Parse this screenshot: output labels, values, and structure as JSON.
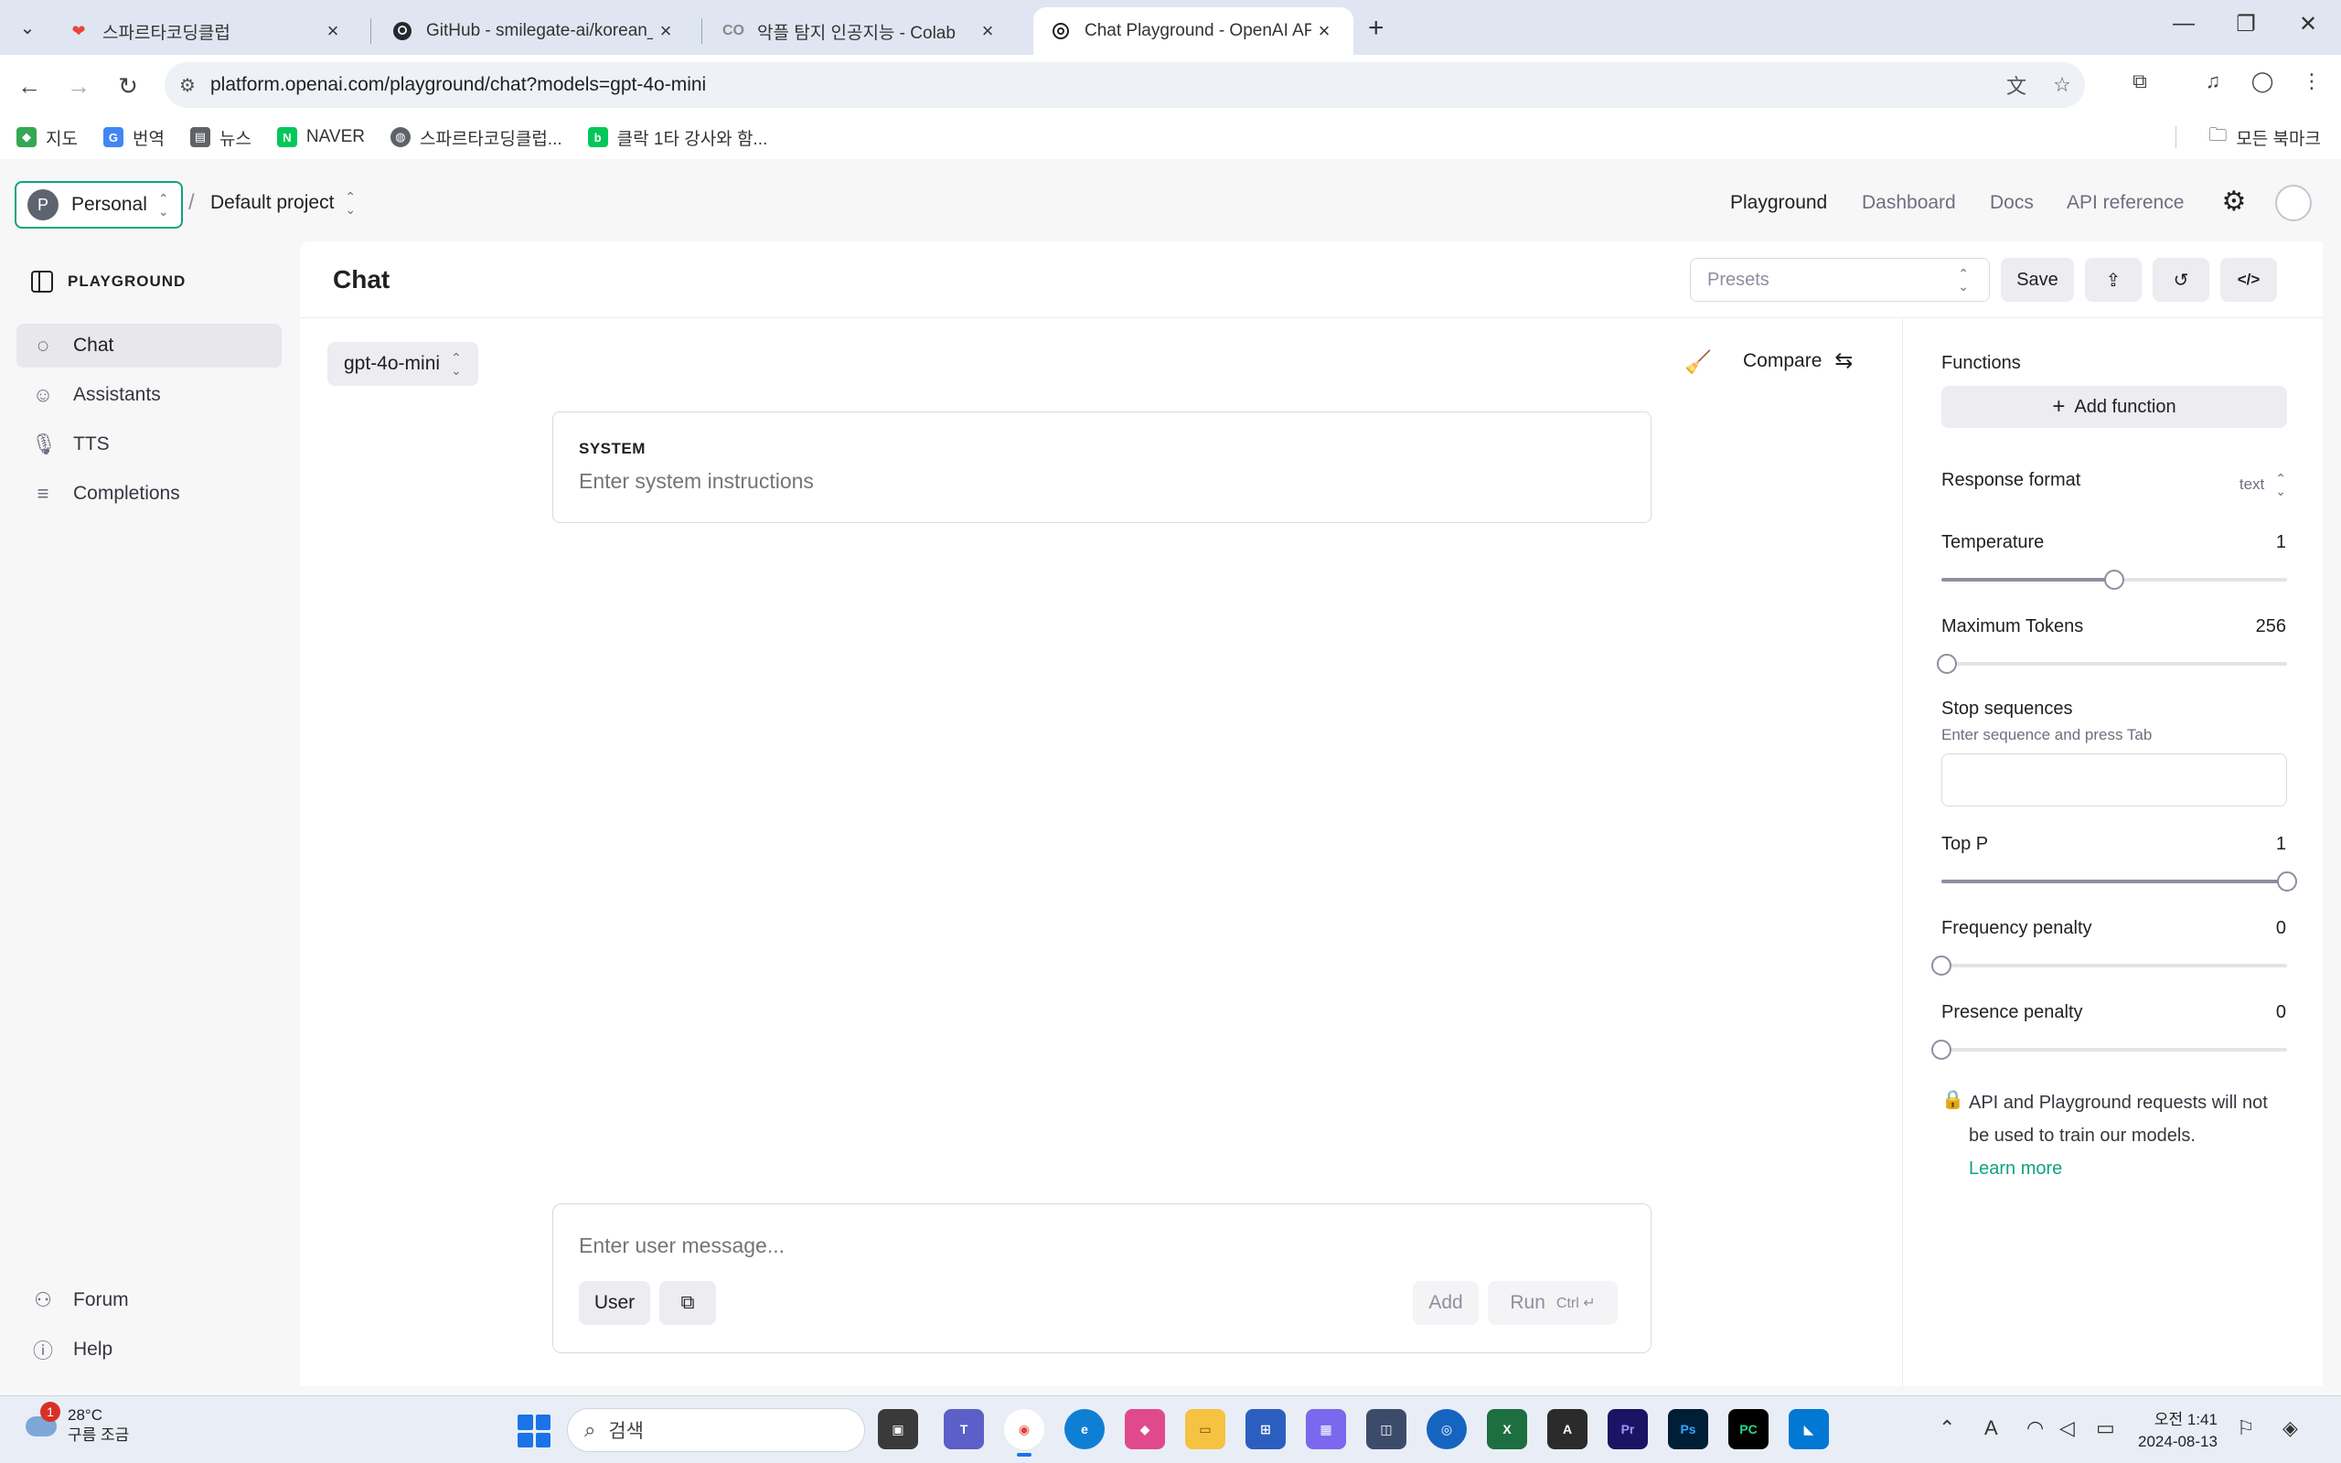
{
  "browser": {
    "tabs": [
      {
        "title": "스파르타코딩클럽",
        "favicon": "heart-icon",
        "color": "#e8453c"
      },
      {
        "title": "GitHub - smilegate-ai/korean_",
        "favicon": "github-icon",
        "color": "#24292f"
      },
      {
        "title": "악플 탐지 인공지능 - Colab",
        "favicon": "colab-icon",
        "color": "#f9ab00"
      },
      {
        "title": "Chat Playground - OpenAI API",
        "favicon": "openai-icon",
        "color": "#202123"
      }
    ],
    "url": "platform.openai.com/playground/chat?models=gpt-4o-mini",
    "bookmarks": [
      {
        "label": "지도",
        "icon": "maps-icon",
        "color": "#34a853"
      },
      {
        "label": "번역",
        "icon": "translate-icon",
        "color": "#4285f4"
      },
      {
        "label": "뉴스",
        "icon": "news-icon",
        "color": "#5f6368"
      },
      {
        "label": "NAVER",
        "icon": "naver-icon",
        "color": "#03c75a"
      },
      {
        "label": "스파르타코딩클럽...",
        "icon": "globe-icon",
        "color": "#5f6368"
      },
      {
        "label": "클락 1타 강사와 함...",
        "icon": "blog-icon",
        "color": "#03c75a"
      }
    ],
    "all_bookmarks": "모든 북마크"
  },
  "header": {
    "org_initial": "P",
    "org": "Personal",
    "project": "Default project",
    "nav": [
      "Playground",
      "Dashboard",
      "Docs",
      "API reference"
    ]
  },
  "sidebar": {
    "section": "PLAYGROUND",
    "items": [
      {
        "label": "Chat",
        "icon": "chat-icon"
      },
      {
        "label": "Assistants",
        "icon": "assistants-icon"
      },
      {
        "label": "TTS",
        "icon": "microphone-icon"
      },
      {
        "label": "Completions",
        "icon": "lines-icon"
      }
    ],
    "footer": [
      {
        "label": "Forum",
        "icon": "people-icon"
      },
      {
        "label": "Help",
        "icon": "help-icon"
      }
    ]
  },
  "main": {
    "title": "Chat",
    "presets_placeholder": "Presets",
    "save_label": "Save",
    "model": "gpt-4o-mini",
    "compare_label": "Compare",
    "system_label": "SYSTEM",
    "system_placeholder": "Enter system instructions",
    "message_placeholder": "Enter user message...",
    "role_label": "User",
    "add_label": "Add",
    "run_label": "Run",
    "run_shortcut": "Ctrl ↵"
  },
  "settings": {
    "functions_label": "Functions",
    "add_function_label": "Add function",
    "response_format_label": "Response format",
    "response_format_value": "text",
    "temperature": {
      "label": "Temperature",
      "value": "1",
      "fraction": 0.5
    },
    "max_tokens": {
      "label": "Maximum Tokens",
      "value": "256",
      "fraction": 0.015
    },
    "stop_sequences": {
      "label": "Stop sequences",
      "hint": "Enter sequence and press Tab"
    },
    "top_p": {
      "label": "Top P",
      "value": "1",
      "fraction": 1.0
    },
    "frequency_penalty": {
      "label": "Frequency penalty",
      "value": "0",
      "fraction": 0.0
    },
    "presence_penalty": {
      "label": "Presence penalty",
      "value": "0",
      "fraction": 0.0
    },
    "privacy_text": "API and Playground requests will not be used to train our models.",
    "learn_more": "Learn more",
    "accent": "#10a37f"
  },
  "taskbar": {
    "temperature": "28°C",
    "weather": "구름 조금",
    "notification_count": "1",
    "search_placeholder": "검색",
    "time": "오전 1:41",
    "date": "2024-08-13"
  }
}
